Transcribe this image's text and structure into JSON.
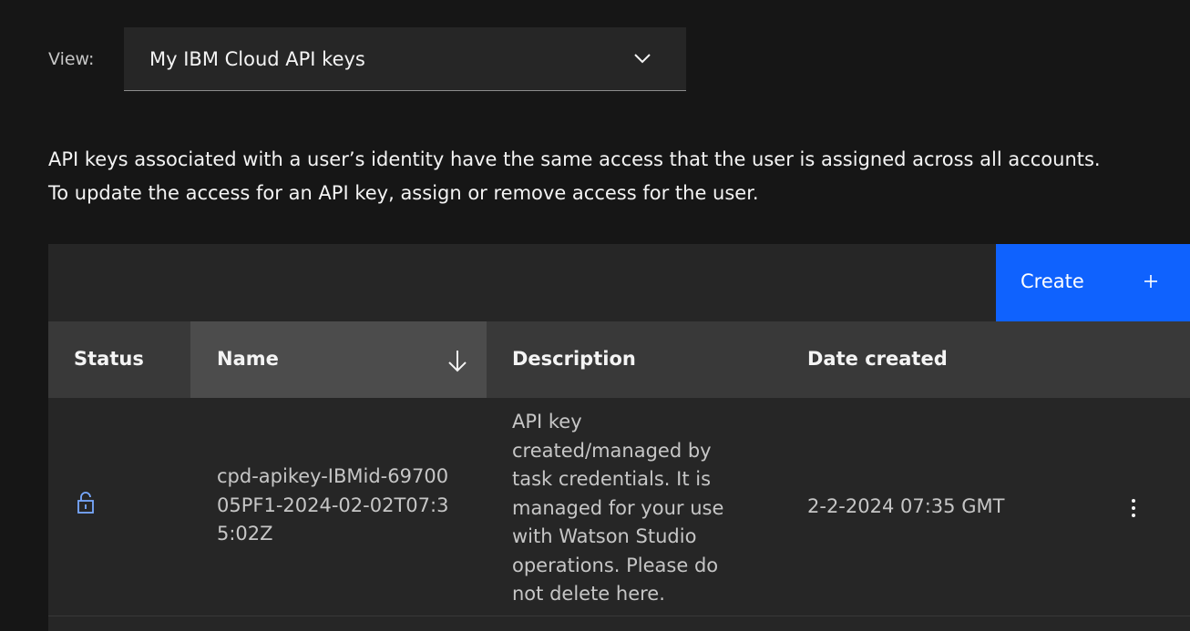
{
  "view": {
    "label": "View:",
    "selected": "My IBM Cloud API keys"
  },
  "description": {
    "line1": "API keys associated with a user’s identity have the same access that the user is assigned across all accounts.",
    "line2": "To update the access for an API key, assign or remove access for the user."
  },
  "toolbar": {
    "create_label": "Create"
  },
  "table": {
    "columns": {
      "status": "Status",
      "name": "Name",
      "description": "Description",
      "date_created": "Date created"
    },
    "sort": {
      "column": "name",
      "direction": "descending"
    },
    "rows": [
      {
        "status_icon": "unlocked-icon",
        "name": "cpd-apikey-IBMid-6970005PF1-2024-02-02T07:35:02Z",
        "description": "API key created/managed by task credentials. It is managed for your use with Watson Studio operations. Please do not delete here.",
        "date_created": "2-2-2024 07:35 GMT"
      }
    ]
  },
  "colors": {
    "background": "#161616",
    "surface": "#262626",
    "header": "#393939",
    "sorted_header": "#4c4c4c",
    "primary": "#0f62fe",
    "icon_accent": "#78a9ff"
  }
}
